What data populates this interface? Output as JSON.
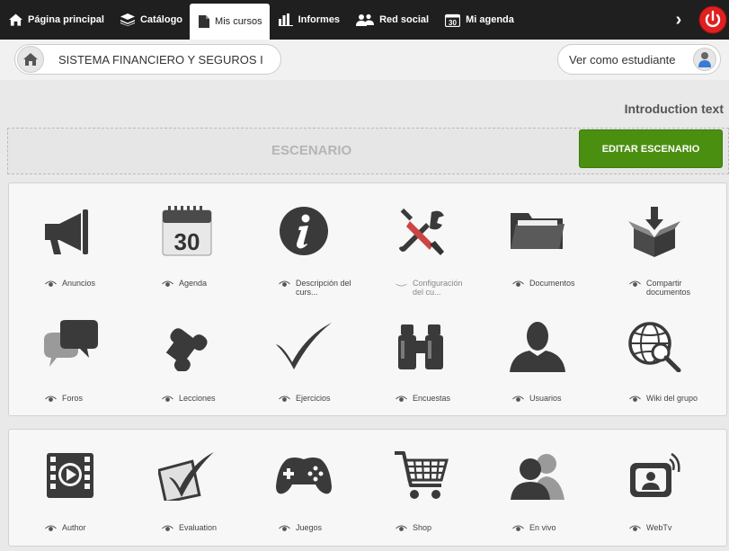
{
  "nav": {
    "items": [
      {
        "label": "Página principal",
        "icon": "home-icon"
      },
      {
        "label": "Catálogo",
        "icon": "layers-icon"
      },
      {
        "label": "Mis cursos",
        "icon": "document-icon",
        "active": true
      },
      {
        "label": "Informes",
        "icon": "bar-chart-icon"
      },
      {
        "label": "Red social",
        "icon": "people-icon"
      },
      {
        "label": "Mi agenda",
        "icon": "calendar-icon"
      }
    ],
    "calendar_day": "30",
    "more_glyph": "›"
  },
  "course": {
    "title": "SISTEMA FINANCIERO Y SEGUROS I",
    "student_view_label": "Ver como estudiante"
  },
  "intro": {
    "text": "Introduction text",
    "scenario_label": "ESCENARIO",
    "edit_button": "EDITAR ESCENARIO"
  },
  "tools_main": [
    {
      "label": "Anuncios",
      "icon": "megaphone-icon"
    },
    {
      "label": "Agenda",
      "icon": "calendar-icon",
      "day": "30"
    },
    {
      "label": "Descripción del curs...",
      "icon": "info-icon"
    },
    {
      "label": "Configuración del cu...",
      "icon": "tools-icon",
      "hidden": true
    },
    {
      "label": "Documentos",
      "icon": "folder-icon"
    },
    {
      "label": "Compartir documentos",
      "icon": "box-download-icon"
    },
    {
      "label": "Foros",
      "icon": "chat-bubbles-icon"
    },
    {
      "label": "Lecciones",
      "icon": "puzzle-icon"
    },
    {
      "label": "Ejercicios",
      "icon": "checkmark-icon"
    },
    {
      "label": "Encuestas",
      "icon": "binoculars-icon"
    },
    {
      "label": "Usuarios",
      "icon": "user-icon"
    },
    {
      "label": "Wiki del grupo",
      "icon": "globe-search-icon"
    }
  ],
  "tools_extra": [
    {
      "label": "Author",
      "icon": "video-film-icon"
    },
    {
      "label": "Evaluation",
      "icon": "checkbox-icon"
    },
    {
      "label": "Juegos",
      "icon": "gamepad-icon"
    },
    {
      "label": "Shop",
      "icon": "cart-icon"
    },
    {
      "label": "En vivo",
      "icon": "group-users-icon"
    },
    {
      "label": "WebTv",
      "icon": "webtv-icon"
    }
  ],
  "colors": {
    "topbar": "#1f1f1f",
    "edit_button": "#4a8f10",
    "power": "#e02020",
    "icon": "#3a3a3a"
  }
}
